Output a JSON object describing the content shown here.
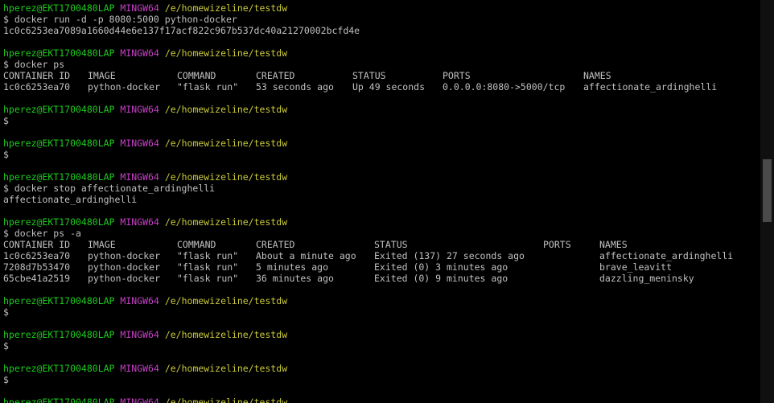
{
  "prompt": {
    "user": "hperez@EKT1700480LAP",
    "system": "MINGW64",
    "path": "/e/homewizeline/testdw",
    "symbol": "$"
  },
  "commands": {
    "run": "$ docker run -d -p 8080:5000 python-docker",
    "run_output": "1c0c6253ea7089a1660d44e6e137f17acf822c967b537dc40a21270002bcfd4e",
    "ps": "$ docker ps",
    "stop": "$ docker stop affectionate_ardinghelli",
    "stop_output": "affectionate_ardinghelli",
    "ps_a": "$ docker ps -a"
  },
  "ps_table": {
    "headers": [
      "CONTAINER ID",
      "IMAGE",
      "COMMAND",
      "CREATED",
      "STATUS",
      "PORTS",
      "NAMES"
    ],
    "rows": [
      [
        "1c0c6253ea70",
        "python-docker",
        "\"flask run\"",
        "53 seconds ago",
        "Up 49 seconds",
        "0.0.0.0:8080->5000/tcp",
        "affectionate_ardinghelli"
      ]
    ]
  },
  "ps_a_table": {
    "headers": [
      "CONTAINER ID",
      "IMAGE",
      "COMMAND",
      "CREATED",
      "STATUS",
      "PORTS",
      "NAMES"
    ],
    "rows": [
      [
        "1c0c6253ea70",
        "python-docker",
        "\"flask run\"",
        "About a minute ago",
        "Exited (137) 27 seconds ago",
        "",
        "affectionate_ardinghelli"
      ],
      [
        "7208d7b53470",
        "python-docker",
        "\"flask run\"",
        "5 minutes ago",
        "Exited (0) 3 minutes ago",
        "",
        "brave_leavitt"
      ],
      [
        "65cbe41a2519",
        "python-docker",
        "\"flask run\"",
        "36 minutes ago",
        "Exited (0) 9 minutes ago",
        "",
        "dazzling_meninsky"
      ]
    ]
  },
  "colors": {
    "background": "#000000",
    "text": "#c0c0c0",
    "user": "#1ecc1e",
    "system": "#c640c6",
    "path": "#c9c93a"
  }
}
